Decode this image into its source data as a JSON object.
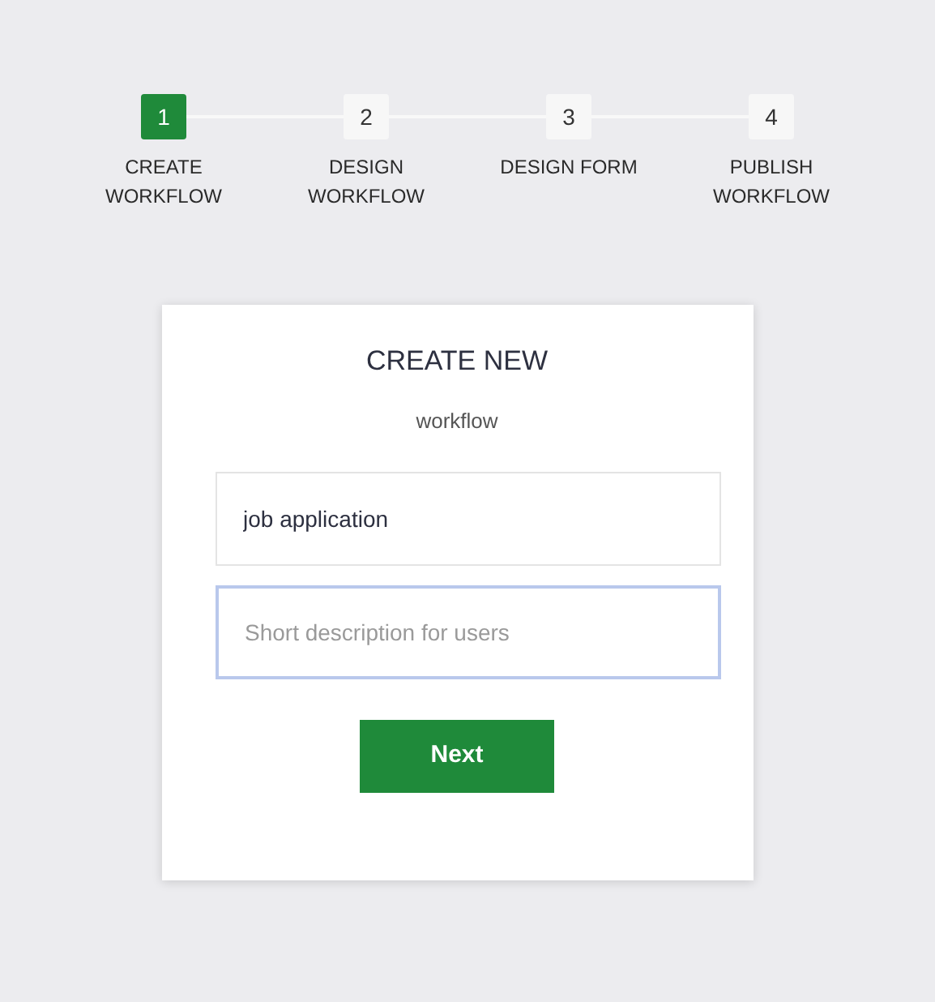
{
  "steps": [
    {
      "number": "1",
      "label": "CREATE WORKFLOW",
      "selected": true
    },
    {
      "number": "2",
      "label": "DESIGN WORKFLOW",
      "selected": false
    },
    {
      "number": "3",
      "label": "DESIGN FORM",
      "selected": false
    },
    {
      "number": "4",
      "label": "PUBLISH WORKFLOW",
      "selected": false
    }
  ],
  "card": {
    "title": "CREATE NEW",
    "subtitle": "workflow",
    "fields": [
      {
        "value": "job application",
        "focused": false
      },
      {
        "placeholder": "Short description for users",
        "focused": true
      }
    ],
    "button": "Next"
  }
}
